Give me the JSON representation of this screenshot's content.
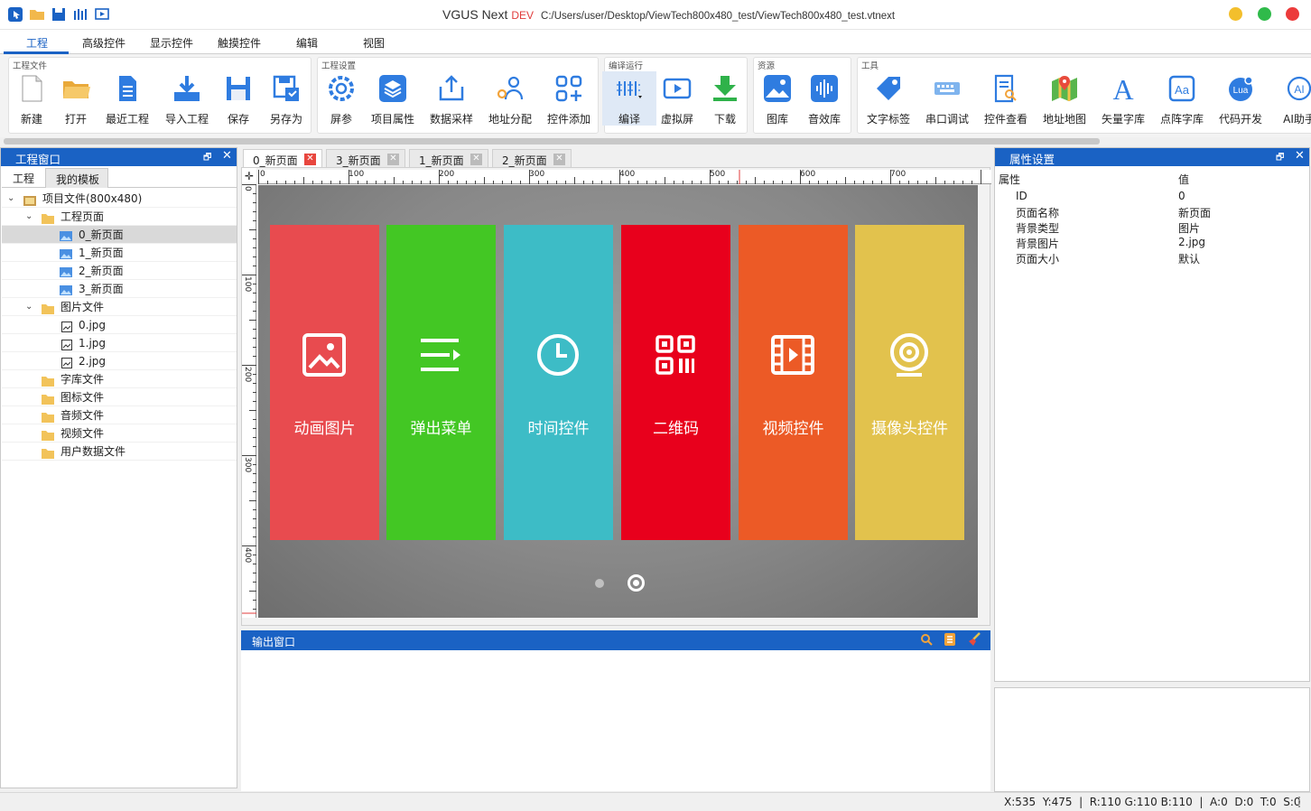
{
  "titlebar": {
    "app": "VGUS Next",
    "dev": "DEV",
    "path": "C:/Users/user/Desktop/ViewTech800x480_test/ViewTech800x480_test.vtnext"
  },
  "menu": [
    "工程",
    "高级控件",
    "显示控件",
    "触摸控件",
    "编辑",
    "视图"
  ],
  "ribbon": {
    "groups": [
      "工程文件",
      "工程设置",
      "编译运行",
      "资源",
      "工具"
    ],
    "file": [
      "新建",
      "打开",
      "最近工程",
      "导入工程",
      "保存",
      "另存为"
    ],
    "settings": [
      "屏参",
      "项目属性",
      "数据采样",
      "地址分配",
      "控件添加"
    ],
    "run": [
      "编译",
      "虚拟屏",
      "下载"
    ],
    "res": [
      "图库",
      "音效库"
    ],
    "tools": [
      "文字标签",
      "串口调试",
      "控件查看",
      "地址地图",
      "矢量字库",
      "点阵字库",
      "代码开发",
      "AI助手"
    ]
  },
  "left": {
    "title": "工程窗口",
    "tabs": [
      "工程",
      "我的模板"
    ],
    "tree": {
      "root": "项目文件(800x480)",
      "pages_folder": "工程页面",
      "pages": [
        "0_新页面",
        "1_新页面",
        "2_新页面",
        "3_新页面"
      ],
      "images_folder": "图片文件",
      "images": [
        "0.jpg",
        "1.jpg",
        "2.jpg"
      ],
      "folders": [
        "字库文件",
        "图标文件",
        "音频文件",
        "视频文件",
        "用户数据文件"
      ]
    }
  },
  "doc_tabs": [
    "0_新页面",
    "3_新页面",
    "1_新页面",
    "2_新页面"
  ],
  "ruler": {
    "h": [
      "0",
      "100",
      "200",
      "300",
      "400",
      "500",
      "600",
      "700"
    ],
    "v": [
      "0",
      "100",
      "200",
      "300",
      "400"
    ]
  },
  "cards": [
    {
      "label": "动画图片",
      "color": "#e84b4f",
      "icon": "image-icon"
    },
    {
      "label": "弹出菜单",
      "color": "#43c724",
      "icon": "menu-icon"
    },
    {
      "label": "时间控件",
      "color": "#3dbcc6",
      "icon": "clock-icon"
    },
    {
      "label": "二维码",
      "color": "#e8001c",
      "icon": "qrcode-icon"
    },
    {
      "label": "视频控件",
      "color": "#ec5a26",
      "icon": "video-icon"
    },
    {
      "label": "摄像头控件",
      "color": "#e2c24d",
      "icon": "camera-icon"
    }
  ],
  "output": {
    "title": "输出窗口"
  },
  "props": {
    "title": "属性设置",
    "col_key": "属性",
    "col_val": "值",
    "rows": [
      {
        "k": "ID",
        "v": "0"
      },
      {
        "k": "页面名称",
        "v": "新页面"
      },
      {
        "k": "背景类型",
        "v": "图片"
      },
      {
        "k": "背景图片",
        "v": "2.jpg"
      },
      {
        "k": "页面大小",
        "v": "默认"
      }
    ]
  },
  "status": "X:535  Y:475  |  R:110 G:110 B:110  |  A:0  D:0  T:0  S:0"
}
